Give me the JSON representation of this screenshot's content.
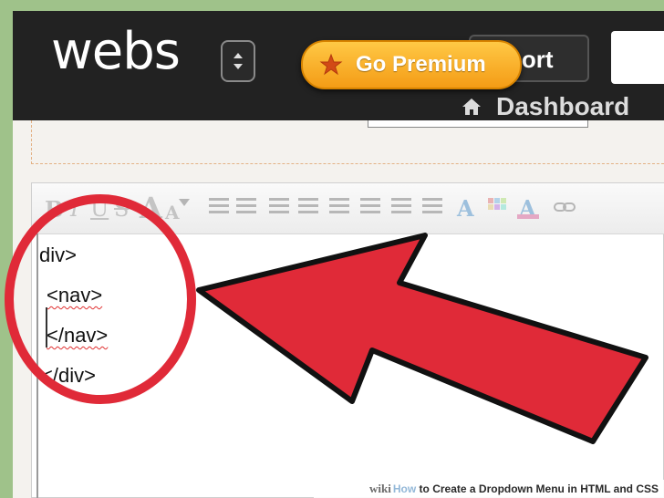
{
  "header": {
    "logo_text": "webs",
    "premium_label": "Go Premium",
    "support_label": "Support",
    "support_visible_text": "port",
    "dashboard_label": "Dashboard"
  },
  "toolbar": {
    "bold": "B",
    "italic": "I",
    "underline": "U",
    "strike": "S",
    "font_size_up": "A",
    "font_size_down": "A"
  },
  "editor": {
    "lines": [
      "div>",
      "<nav>",
      "</nav>",
      "</div>"
    ]
  },
  "footer": {
    "wiki": "wiki",
    "how": "How",
    "rest": "to Create a Dropdown Menu in HTML and CSS"
  },
  "colors": {
    "header_bg": "#222222",
    "premium_gradient_top": "#ffc845",
    "premium_gradient_bottom": "#f49c16",
    "annotation_red": "#e02a38",
    "frame_green": "#9fc28a"
  },
  "icons": {
    "switcher": "chevron-up-down-icon",
    "premium": "star-icon",
    "dashboard": "home-icon"
  }
}
